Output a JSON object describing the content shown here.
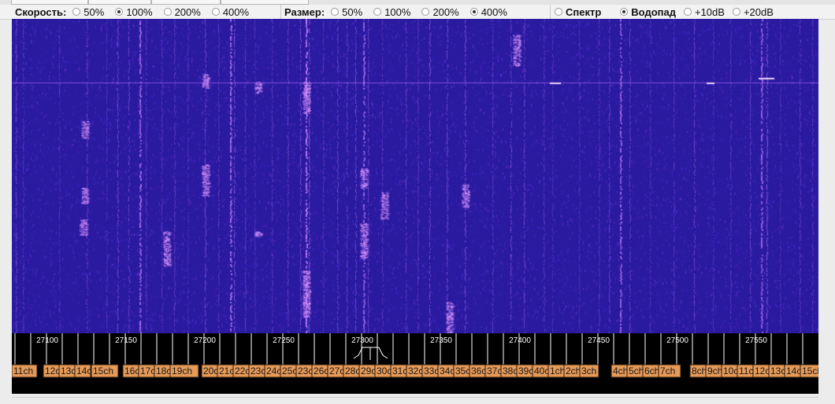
{
  "speed": {
    "label": "Скорость:",
    "options": [
      {
        "label": "50%",
        "selected": false
      },
      {
        "label": "100%",
        "selected": true
      },
      {
        "label": "200%",
        "selected": false
      },
      {
        "label": "400%",
        "selected": false
      }
    ]
  },
  "size": {
    "label": "Размер:",
    "options": [
      {
        "label": "50%",
        "selected": false
      },
      {
        "label": "100%",
        "selected": false
      },
      {
        "label": "200%",
        "selected": false
      },
      {
        "label": "400%",
        "selected": true
      }
    ]
  },
  "view": {
    "options": [
      {
        "label": "Спектр",
        "selected": false,
        "bold": true
      },
      {
        "label": "Водопад",
        "selected": true,
        "bold": true
      },
      {
        "label": "+10dB",
        "selected": false,
        "bold": false
      },
      {
        "label": "+20dB",
        "selected": false,
        "bold": false
      }
    ]
  },
  "frequency_scale": {
    "labels": [
      "27100",
      "27150",
      "27200",
      "27250",
      "27300",
      "27350",
      "27400",
      "27450",
      "27500",
      "27550"
    ]
  },
  "channels": [
    "11ch",
    "12ch",
    "13ch",
    "14ch",
    "15ch",
    "16ch",
    "17ch",
    "18ch",
    "19ch",
    "20ch",
    "21ch",
    "22ch",
    "23ch",
    "24ch",
    "25ch",
    "23ch",
    "26ch",
    "27ch",
    "28ch",
    "29ch",
    "30ch",
    "31ch",
    "32ch",
    "33ch",
    "34ch",
    "35ch",
    "36ch",
    "37ch",
    "38ch",
    "39ch",
    "40ch",
    "1ch",
    "2ch",
    "3ch",
    "4ch",
    "5ch",
    "6ch",
    "7ch",
    "8ch",
    "9ch",
    "10ch",
    "11ch",
    "12ch",
    "13ch",
    "14ch",
    "15ch"
  ],
  "colors": {
    "waterfall_background": "#2a1aa0",
    "signal": "#c27cff",
    "channel_tag": "#e69a58"
  }
}
